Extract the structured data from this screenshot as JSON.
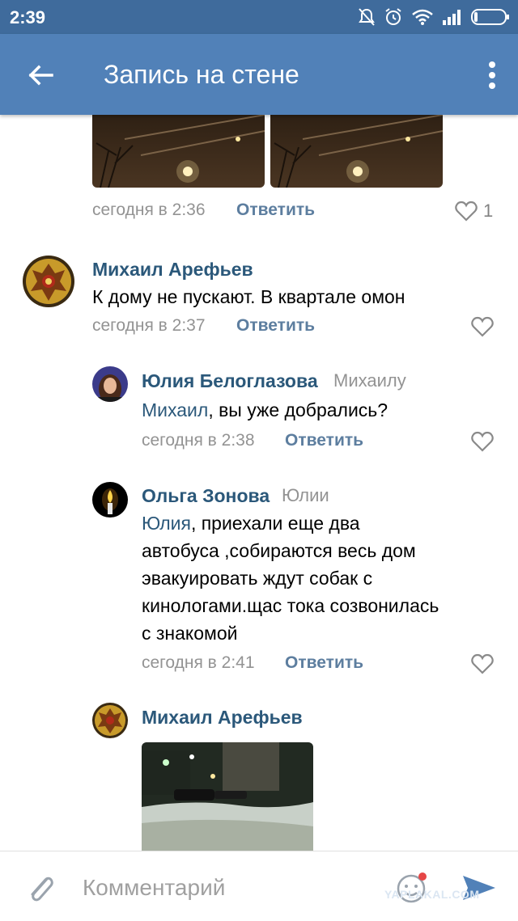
{
  "status_bar": {
    "time": "2:39"
  },
  "app_bar": {
    "title": "Запись на стене"
  },
  "comments": [
    {
      "timestamp": "сегодня в 2:36",
      "reply_label": "Ответить",
      "likes": "1"
    },
    {
      "author": "Михаил Арефьев",
      "text": "К дому не пускают. В квартале омон",
      "timestamp": "сегодня в 2:37",
      "reply_label": "Ответить"
    },
    {
      "author": "Юлия Белоглазова",
      "reply_to": "Михаилу",
      "mention": "Михаил",
      "text": ", вы уже добрались?",
      "timestamp": "сегодня в 2:38",
      "reply_label": "Ответить"
    },
    {
      "author": "Ольга Зонова",
      "reply_to": "Юлии",
      "mention": "Юлия",
      "text_lines": [
        ", приехали еще два",
        "автобуса ,собираются весь дом",
        "эвакуировать ждут собак с",
        "кинологами.щас тока созвонилась",
        "с знакомой"
      ],
      "timestamp": "сегодня в 2:41",
      "reply_label": "Ответить"
    },
    {
      "author": "Михаил Арефьев"
    }
  ],
  "composer": {
    "placeholder": "Комментарий"
  },
  "watermark": "YAPLAKAL.COM",
  "colors": {
    "app_bar": "#5181b8",
    "status_bar": "#3f6b9c",
    "author": "#2b587a",
    "reply": "#5d7e9f",
    "meta": "#939393"
  }
}
